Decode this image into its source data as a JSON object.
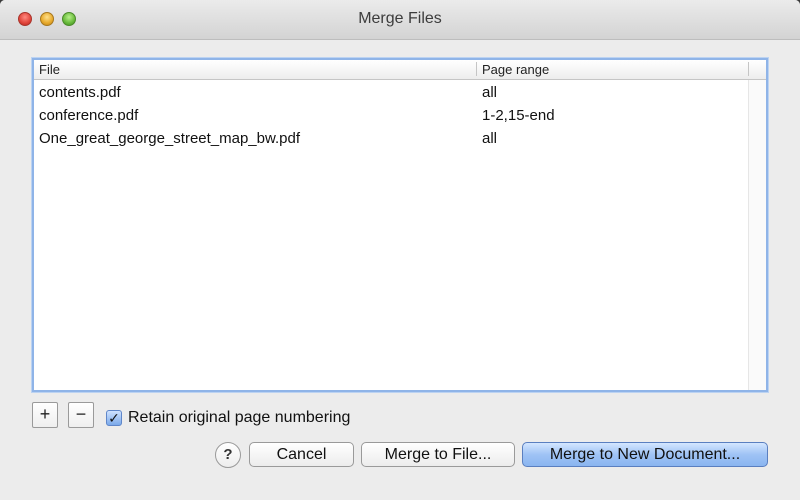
{
  "window": {
    "title": "Merge Files"
  },
  "table": {
    "columns": {
      "file": "File",
      "page_range": "Page range"
    },
    "rows": [
      {
        "file": "contents.pdf",
        "page_range": "all"
      },
      {
        "file": "conference.pdf",
        "page_range": "1-2,15-end"
      },
      {
        "file": "One_great_george_street_map_bw.pdf",
        "page_range": "all"
      }
    ]
  },
  "controls": {
    "add_label": "+",
    "remove_label": "−",
    "retain_numbering_label": "Retain original page numbering",
    "retain_numbering_checked": true,
    "checkmark": "✓",
    "help_label": "?",
    "cancel_label": "Cancel",
    "merge_to_file_label": "Merge to File...",
    "merge_to_new_label": "Merge to New Document..."
  },
  "colors": {
    "accent": "#8fb4e8",
    "default_button": "#9fc3f5"
  }
}
